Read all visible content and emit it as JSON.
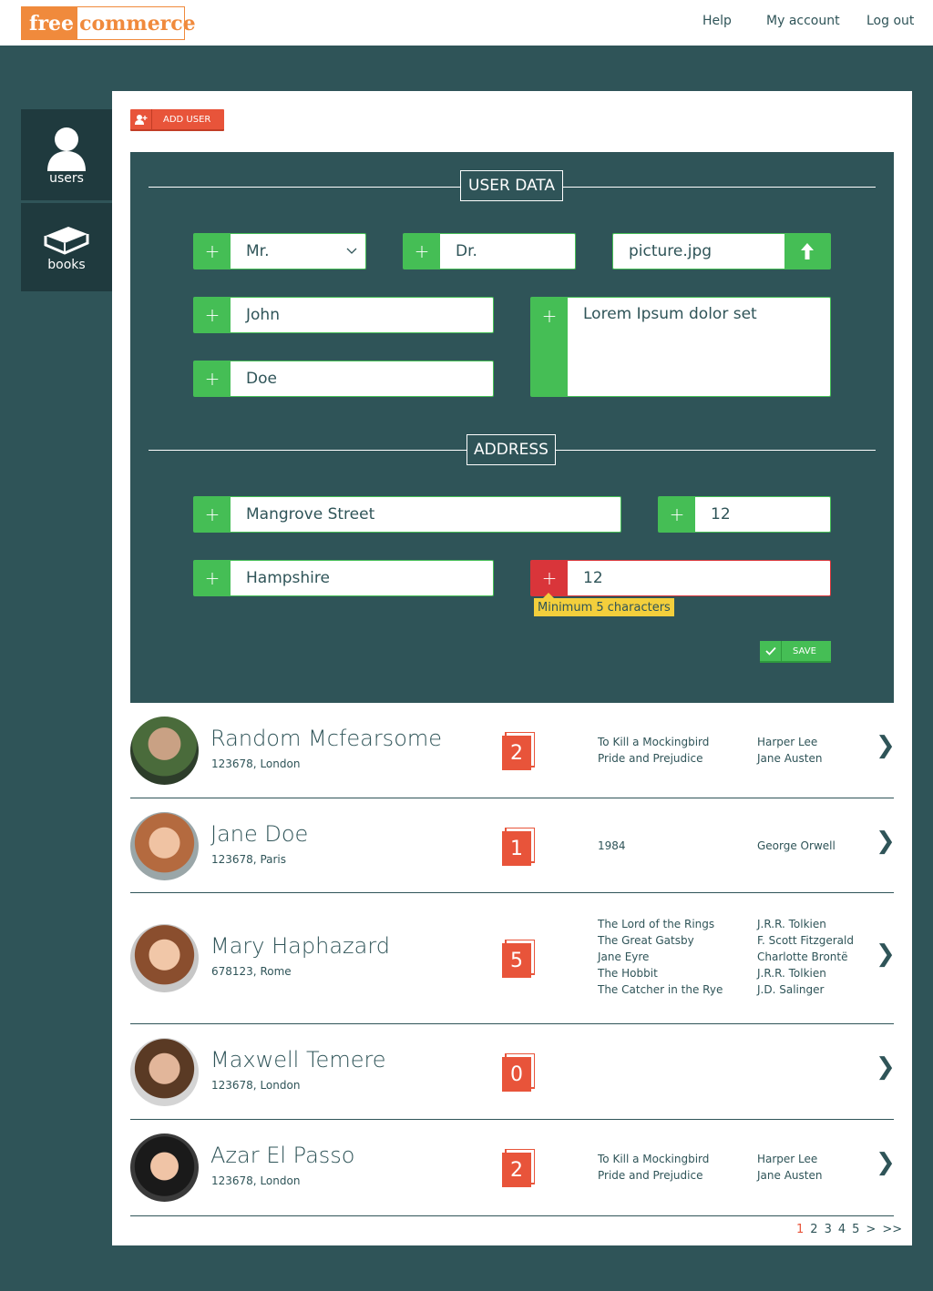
{
  "header": {
    "logo_free": "free",
    "logo_commerce": "commerce",
    "nav": [
      "Help",
      "My account",
      "Log out"
    ]
  },
  "sidebar": {
    "items": [
      {
        "label": "users",
        "icon": "user-icon"
      },
      {
        "label": "books",
        "icon": "book-icon"
      }
    ]
  },
  "toolbar": {
    "add_user_label": "ADD USER"
  },
  "form": {
    "user_data_title": "USER DATA",
    "address_title": "ADDRESS",
    "salutation": "Mr.",
    "title": "Dr.",
    "picture": "picture.jpg",
    "first_name": "John",
    "last_name": "Doe",
    "description": "Lorem Ipsum dolor set",
    "street": "Mangrove Street",
    "house_number": "12",
    "city": "Hampshire",
    "zip": "12",
    "zip_error": "Minimum 5 characters",
    "save_label": "SAVE",
    "plus": "+"
  },
  "users": [
    {
      "name": "Random Mcfearsome",
      "address": "123678, London",
      "book_count": "2",
      "titles": [
        "To Kill a Mockingbird",
        "Pride and Prejudice"
      ],
      "authors": [
        "Harper Lee",
        "Jane Austen"
      ]
    },
    {
      "name": "Jane Doe",
      "address": "123678, Paris",
      "book_count": "1",
      "titles": [
        "1984"
      ],
      "authors": [
        "George Orwell"
      ]
    },
    {
      "name": "Mary Haphazard",
      "address": "678123, Rome",
      "book_count": "5",
      "titles": [
        "The Lord of the Rings",
        "The Great Gatsby",
        "Jane Eyre",
        "The Hobbit",
        "The Catcher in the Rye"
      ],
      "authors": [
        "J.R.R. Tolkien",
        "F. Scott Fitzgerald",
        "Charlotte Brontë",
        "J.R.R. Tolkien",
        "J.D. Salinger"
      ]
    },
    {
      "name": "Maxwell Temere",
      "address": "123678, London",
      "book_count": "0",
      "titles": [],
      "authors": []
    },
    {
      "name": "Azar El Passo",
      "address": "123678, London",
      "book_count": "2",
      "titles": [
        "To Kill a Mockingbird",
        "Pride and Prejudice"
      ],
      "authors": [
        "Harper Lee",
        "Jane Austen"
      ]
    }
  ],
  "pagination": {
    "pages": [
      "1",
      "2",
      "3",
      "4",
      "5"
    ],
    "next": ">",
    "last": ">>",
    "current": "1"
  },
  "colors": {
    "accent": "#e8543a",
    "green": "#45be55",
    "teal": "#2f5458",
    "error": "#d9353a",
    "warning": "#f3cf3c",
    "logo": "#f08a3c"
  }
}
